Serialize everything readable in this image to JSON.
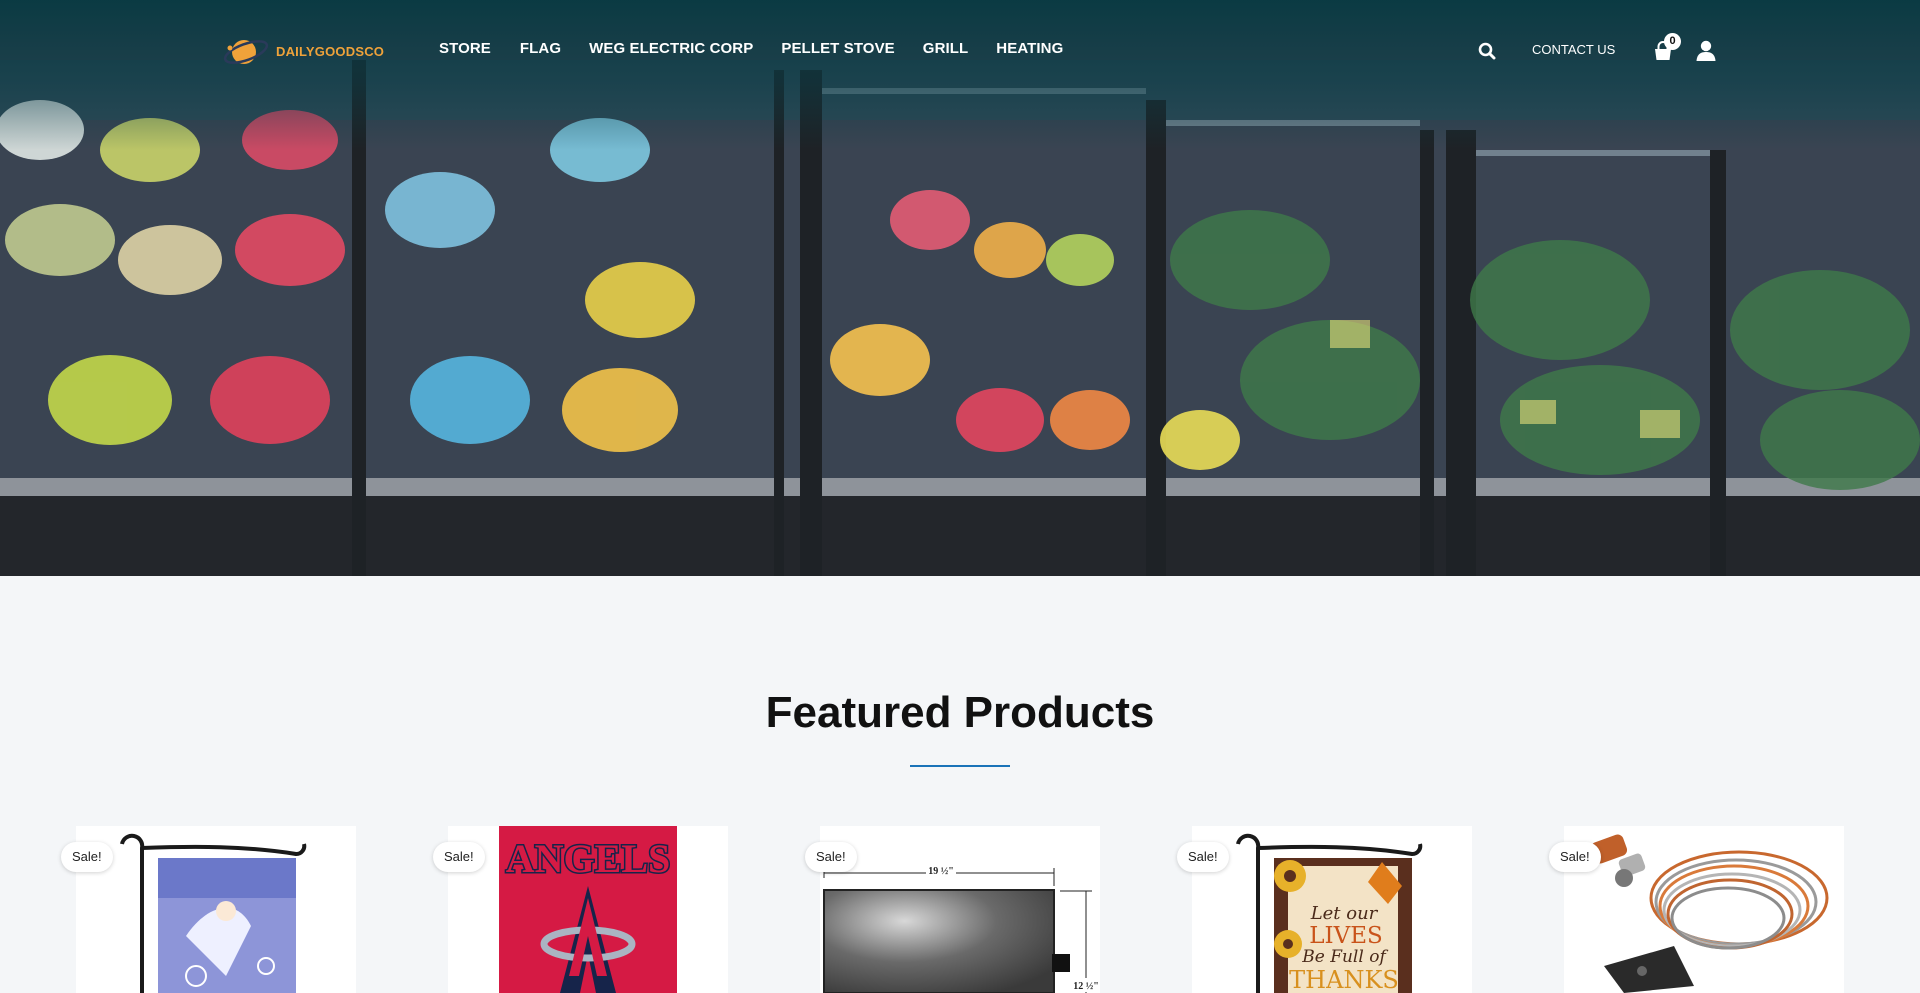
{
  "brand": {
    "name": "DAILYGOODSCO",
    "accent": "#f0a23a"
  },
  "nav": {
    "items": [
      {
        "label": "STORE"
      },
      {
        "label": "FLAG"
      },
      {
        "label": "WEG ELECTRIC CORP"
      },
      {
        "label": "PELLET STOVE"
      },
      {
        "label": "GRILL"
      },
      {
        "label": "HEATING"
      }
    ]
  },
  "header_right": {
    "search_icon": "search-icon",
    "contact_label": "CONTACT US",
    "cart_icon": "shopping-bag-icon",
    "cart_count": "0",
    "user_icon": "user-icon"
  },
  "hero": {
    "image": "refrigerated produce display case"
  },
  "featured": {
    "title": "Featured Products",
    "rule_color": "#1a73b8",
    "products": [
      {
        "badge": "Sale!",
        "image": "angel garden flag"
      },
      {
        "badge": "Sale!",
        "image": "ANGELS flag"
      },
      {
        "badge": "Sale!",
        "image": "metal panel with dimensions",
        "dim_top": "19 ½\"",
        "dim_side": "12 ½\""
      },
      {
        "badge": "Sale!",
        "image": "Let our LIVES Be Full of THANKS garden flag",
        "flag_text": [
          "Let our",
          "LIVES",
          "Be Full of",
          "THANKS"
        ]
      },
      {
        "badge": "Sale!",
        "image": "thermocouple coil"
      }
    ],
    "angels_text": "ANGELS"
  }
}
